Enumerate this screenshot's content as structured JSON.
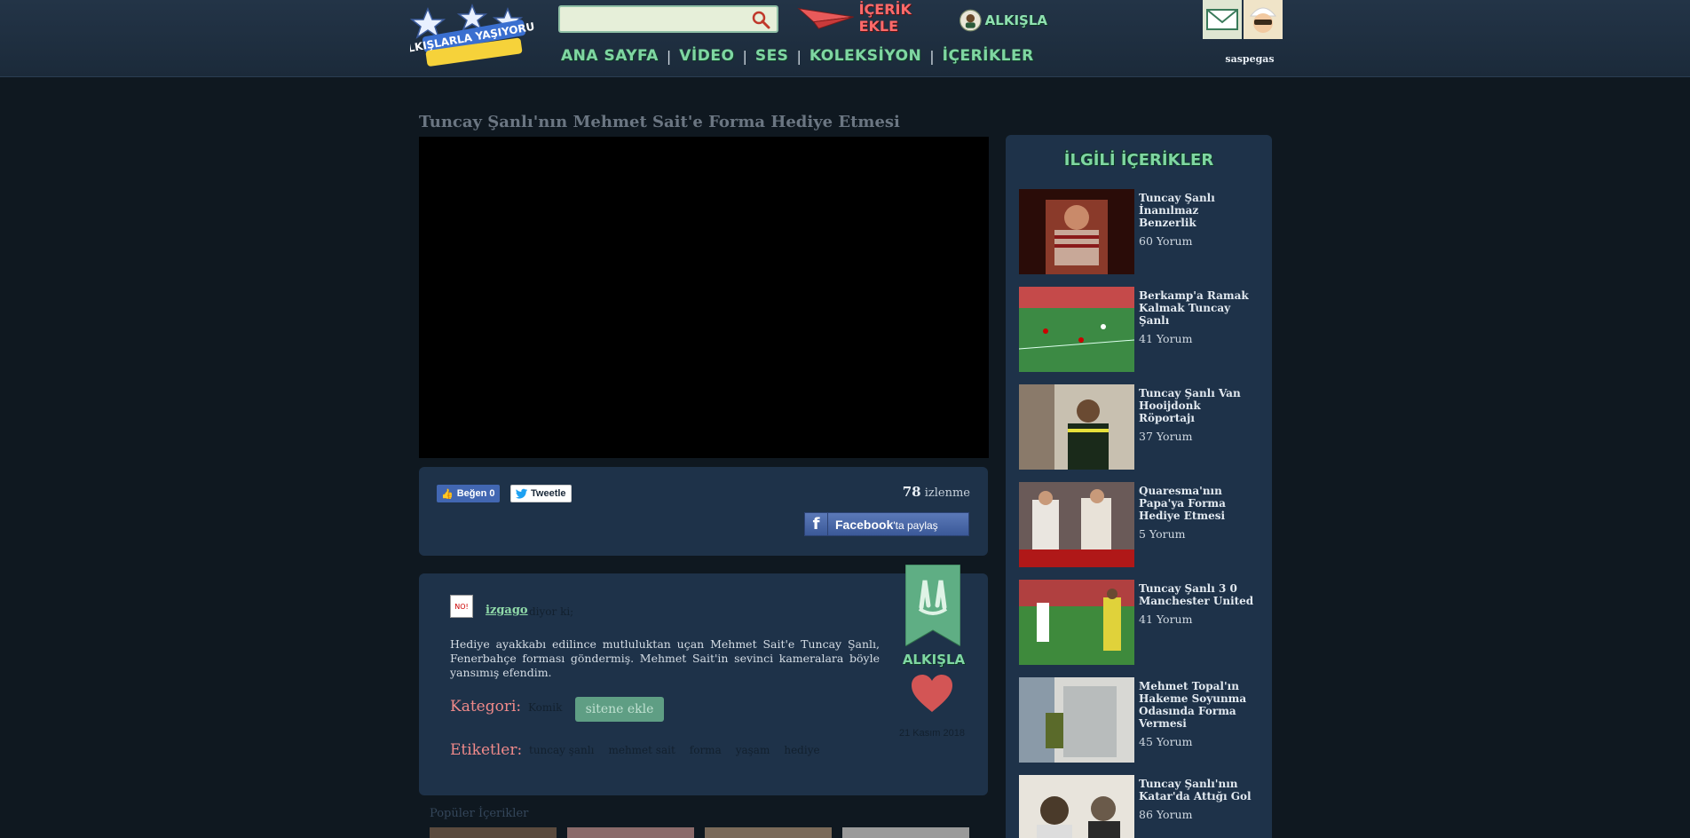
{
  "header": {
    "logo_text": "ALKIŞLARLA YAŞIYORUM",
    "search": {
      "value": "",
      "placeholder": ""
    },
    "nav": [
      "ANA SAYFA",
      "VİDEO",
      "SES",
      "KOLEKSİYON",
      "İÇERİKLER"
    ],
    "add_content": "İÇERİK EKLE",
    "clap": "ALKIŞLA",
    "username": "saspegas"
  },
  "video": {
    "title": "Tuncay Şanlı'nın Mehmet Sait'e Forma Hediye Etmesi"
  },
  "share": {
    "like": "Beğen 0",
    "tweet": "Tweetle",
    "views_count": "78",
    "views_label": "izlenme",
    "fb_share": "Facebook",
    "fb_share_suffix": "'ta paylaş"
  },
  "description": {
    "author": "izgago",
    "says": "diyor ki;",
    "text": "Hediye ayakkabı edilince mutluluktan uçan Mehmet Sait'e Tuncay Şanlı, Fenerbahçe forması göndermiş. Mehmet Sait'in sevinci kameralara böyle yansımış efendim.",
    "category_label": "Kategori:",
    "category": "Komik",
    "add_site": "sitene ekle",
    "tags_label": "Etiketler:",
    "tags": [
      "tuncay şanlı",
      "mehmet sait",
      "forma",
      "yaşam",
      "hediye"
    ],
    "badge_label": "ALKIŞLA",
    "date": "21 Kasım 2018",
    "popular_label": "Popüler İçerikler"
  },
  "sidebar": {
    "title": "İLGİLİ İÇERİKLER",
    "items": [
      {
        "title": "Tuncay Şanlı İnanılmaz Benzerlik",
        "count": "60 Yorum",
        "thumb_color": "#5a1a12"
      },
      {
        "title": "Berkamp'a Ramak Kalmak Tuncay Şanlı",
        "count": "41 Yorum",
        "thumb_color": "#3f7a3a"
      },
      {
        "title": "Tuncay Şanlı Van Hooijdonk Röportajı",
        "count": "37 Yorum",
        "thumb_color": "#2d3a2a"
      },
      {
        "title": "Quaresma'nın Papa'ya Forma Hediye Etmesi",
        "count": "5 Yorum",
        "thumb_color": "#7a6a66"
      },
      {
        "title": "Tuncay Şanlı 3 0 Manchester United",
        "count": "41 Yorum",
        "thumb_color": "#3d7a3a"
      },
      {
        "title": "Mehmet Topal'ın Hakeme Soyunma Odasında Forma Vermesi",
        "count": "45 Yorum",
        "thumb_color": "#8a8a86"
      },
      {
        "title": "Tuncay Şanlı'nın Katar'da Attığı Gol",
        "count": "86 Yorum",
        "thumb_color": "#6a6a5a"
      }
    ]
  }
}
